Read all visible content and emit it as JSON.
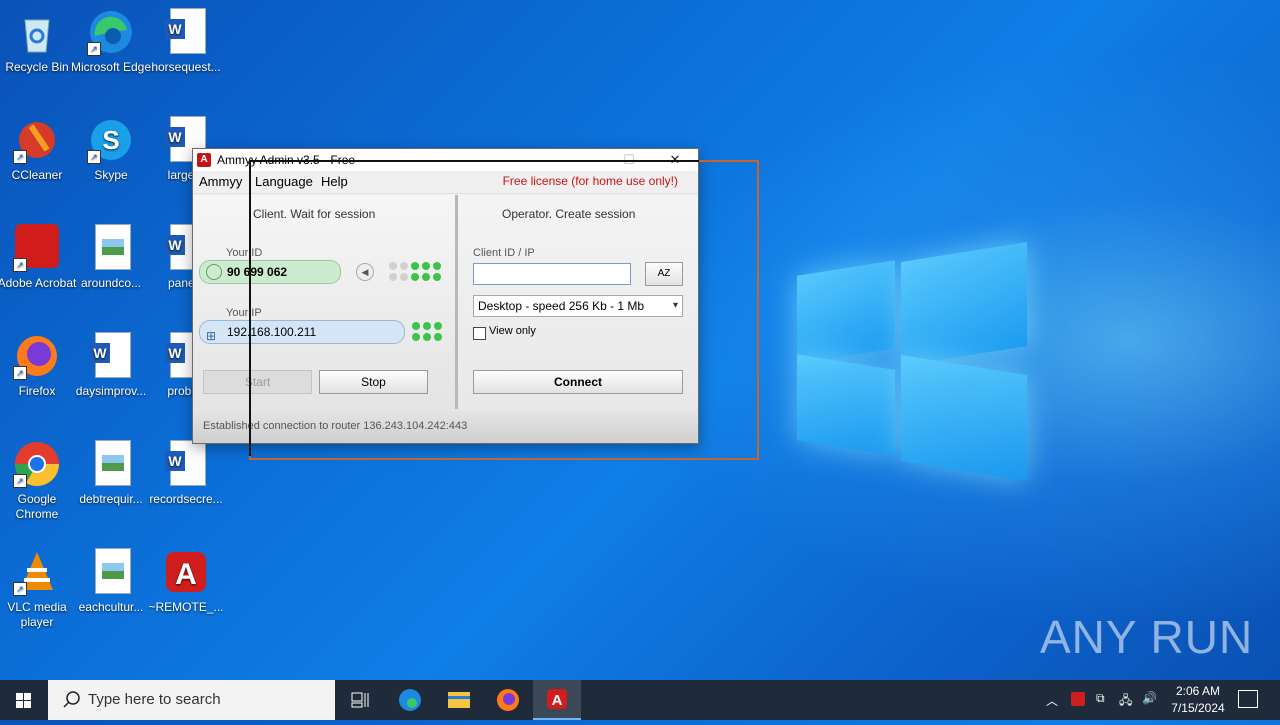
{
  "desktop": {
    "icons": [
      {
        "label": "Recycle Bin"
      },
      {
        "label": "Microsoft Edge"
      },
      {
        "label": "horsequest..."
      },
      {
        "label": "CCleaner"
      },
      {
        "label": "Skype"
      },
      {
        "label": "largerc"
      },
      {
        "label": "Adobe Acrobat"
      },
      {
        "label": "aroundco..."
      },
      {
        "label": "panela"
      },
      {
        "label": "Firefox"
      },
      {
        "label": "daysimprov..."
      },
      {
        "label": "probler"
      },
      {
        "label": "Google Chrome"
      },
      {
        "label": "debtrequir..."
      },
      {
        "label": "recordsecre..."
      },
      {
        "label": "VLC media player"
      },
      {
        "label": "eachcultur..."
      },
      {
        "label": "~REMOTE_..."
      }
    ]
  },
  "ammyy": {
    "title": "Ammyy Admin v3.5 - Free",
    "menu": {
      "ammyy": "Ammyy",
      "language": "Language",
      "help": "Help"
    },
    "license_notice": "Free license (for home use only!)",
    "client": {
      "heading": "Client. Wait for session",
      "your_id_label": "Your ID",
      "your_id": "90 699 062",
      "your_ip_label": "Your IP",
      "your_ip": "192.168.100.211",
      "start_label": "Start",
      "stop_label": "Stop"
    },
    "operator": {
      "heading": "Operator. Create session",
      "client_id_label": "Client ID / IP",
      "client_id_value": "",
      "az_label": "AZ",
      "speed_select": "Desktop - speed  256 Kb - 1 Mb",
      "view_only_label": "View only",
      "connect_label": "Connect"
    },
    "status": "Established connection to router 136.243.104.242:443"
  },
  "taskbar": {
    "search_placeholder": "Type here to search",
    "time": "2:06 AM",
    "date": "7/15/2024"
  },
  "watermark": "ANY RUN"
}
